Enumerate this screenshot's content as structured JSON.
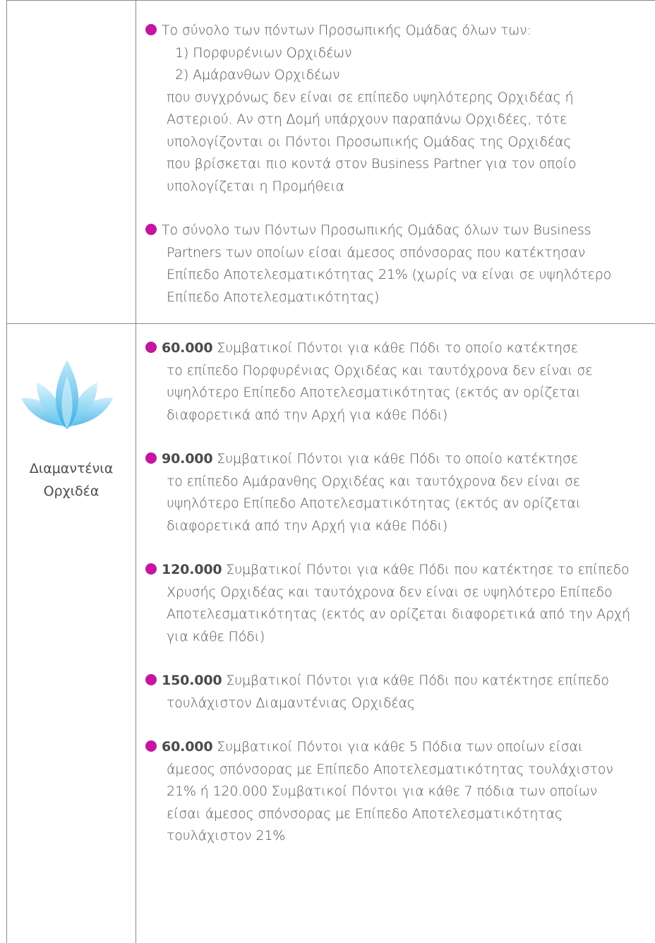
{
  "row1": {
    "item1": {
      "line1": "Το σύνολο των πόντων Προσωπικής Ομάδας όλων των:",
      "line2": "1) Πορφυρένιων Ορχιδέων",
      "line3": "2) Αμάρανθων Ορχιδέων",
      "line4": "που συγχρόνως δεν είναι σε επίπεδο υψηλότερης Ορχιδέας ή",
      "line5": "Αστεριού. Αν στη Δομή υπάρχουν παραπάνω Ορχιδέες, τότε",
      "line6": "υπολογίζονται οι Πόντοι Προσωπικής Ομάδας της Ορχιδέας",
      "line7": "που  βρίσκεται πιο κοντά στον Business Partner για τον οποίο",
      "line8": "υπολογίζεται η Προμήθεια"
    },
    "item2": {
      "line1": "Το σύνολο των Πόντων Προσωπικής Ομάδας όλων των Business",
      "line2": "Partners των οποίων είσαι άμεσος σπόνσορας που κατέκτησαν",
      "line3": "Επίπεδο Αποτελεσματικότητας 21% (χωρίς να είναι σε υψηλότερο",
      "line4": "Επίπεδο Αποτελεσματικότητας)"
    }
  },
  "row2": {
    "label_line1": "Διαμαντένια",
    "label_line2": "Ορχιδέα",
    "icon": "lotus-icon",
    "items": [
      {
        "bold": "60.000",
        "first": " Συμβατικοί Πόντοι για κάθε Πόδι το οποίο κατέκτησε",
        "rest": [
          "το επίπεδο Πορφυρένιας Ορχιδέας και ταυτόχρονα δεν είναι σε",
          "υψηλότερο Επίπεδο Αποτελεσματικότητας (εκτός αν ορίζεται",
          "διαφορετικά από την Αρχή για κάθε Πόδι)"
        ]
      },
      {
        "bold": "90.000",
        "first": " Συμβατικοί Πόντοι για κάθε Πόδι το οποίο κατέκτησε",
        "rest": [
          "το επίπεδο Αμάρανθης Ορχιδέας και ταυτόχρονα δεν είναι σε",
          "υψηλότερο Επίπεδο Αποτελεσματικότητας (εκτός αν ορίζεται",
          "διαφορετικά από την Αρχή για κάθε Πόδι)"
        ]
      },
      {
        "bold": "120.000",
        "first": " Συμβατικοί Πόντοι για κάθε Πόδι που κατέκτησε το επίπεδο",
        "rest": [
          "Χρυσής Ορχιδέας και ταυτόχρονα δεν είναι σε υψηλότερο Επίπεδο",
          "Αποτελεσματικότητας (εκτός αν ορίζεται διαφορετικά από την Αρχή",
          "για κάθε Πόδι)"
        ]
      },
      {
        "bold": "150.000",
        "first": " Συμβατικοί Πόντοι για κάθε Πόδι που κατέκτησε επίπεδο",
        "rest": [
          "τουλάχιστον Διαμαντένιας Ορχιδέας"
        ]
      },
      {
        "bold": "60.000",
        "first": " Συμβατικοί Πόντοι για κάθε 5 Πόδια των οποίων είσαι",
        "rest": [
          "άμεσος σπόνσορας με Επίπεδο Αποτελεσματικότητας τουλάχιστον",
          "21% ή 120.000 Συμβατικοί Πόντοι για κάθε 7 πόδια των οποίων",
          "είσαι άμεσος σπόνσορας με Επίπεδο Αποτελεσματικότητας",
          "τουλάχιστον 21%"
        ]
      }
    ]
  },
  "colors": {
    "bullet": "#c4169f",
    "lotus": "#5fc4ee",
    "border": "#8a8a8a"
  }
}
